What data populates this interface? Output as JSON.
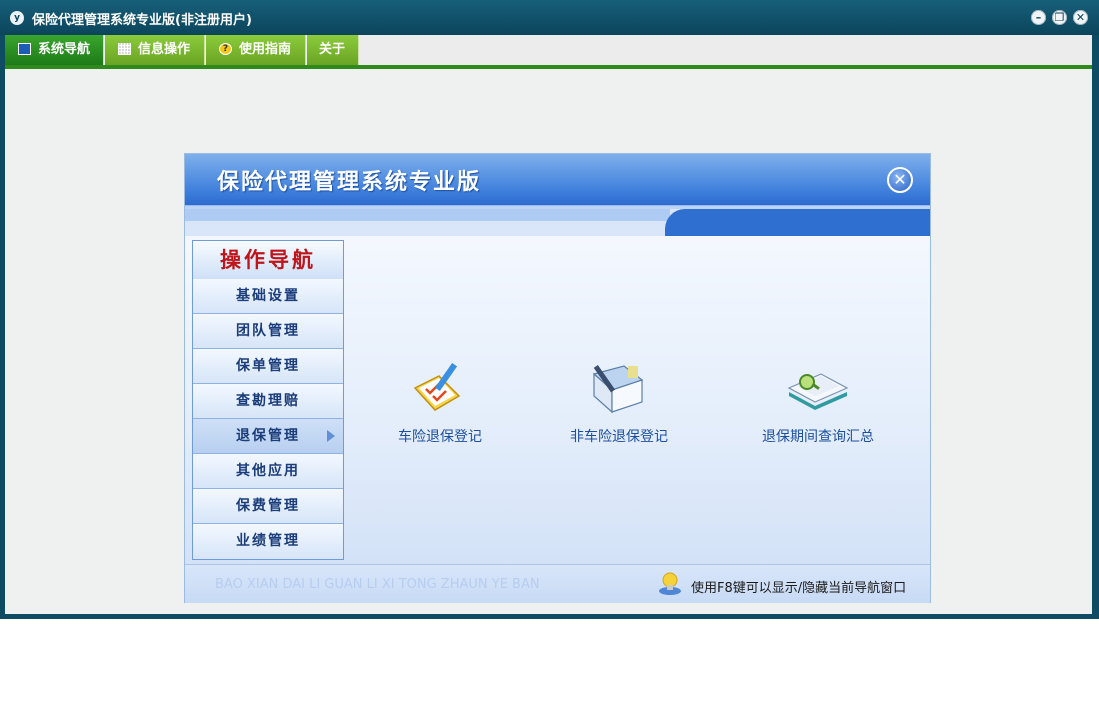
{
  "window": {
    "title": "保险代理管理系统专业版(非注册用户)",
    "app_icon": "y"
  },
  "window_controls": {
    "minimize_icon": "minimize-icon",
    "restore_icon": "restore-icon",
    "close_icon": "close-icon"
  },
  "menu": {
    "items": [
      {
        "label": "系统导航",
        "icon": "monitor-icon",
        "active": true
      },
      {
        "label": "信息操作",
        "icon": "grid-icon"
      },
      {
        "label": "使用指南",
        "icon": "help-icon"
      },
      {
        "label": "关于"
      }
    ]
  },
  "panel": {
    "title": "保险代理管理系统专业版",
    "nav_title": "操作导航",
    "nav_items": [
      "基础设置",
      "团队管理",
      "保单管理",
      "查勘理赔",
      "退保管理",
      "其他应用",
      "保费管理",
      "业绩管理"
    ],
    "active_nav": "退保管理",
    "functions": [
      {
        "label": "车险退保登记",
        "icon": "pencil-checklist-icon"
      },
      {
        "label": "非车险退保登记",
        "icon": "notebook-pen-icon"
      },
      {
        "label": "退保期间查询汇总",
        "icon": "search-book-icon"
      }
    ],
    "footer_subtitle": "BAO XIAN DAI LI GUAN LI XI TONG ZHAUN YE BAN",
    "footer_tip": "使用F8键可以显示/隐藏当前导航窗口"
  },
  "colors": {
    "titlebar": "#0d4c63",
    "menu_active": "#1d7a18",
    "menu_item": "#7ab830",
    "panel_blue": "#2d6ccf",
    "nav_title": "#c0141b"
  }
}
